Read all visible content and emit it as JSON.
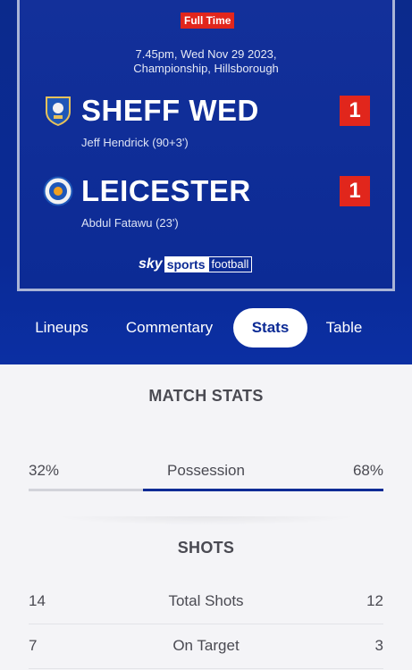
{
  "match": {
    "status": "Full Time",
    "datetime": "7.45pm, Wed Nov 29 2023,",
    "venue": "Championship, Hillsborough",
    "home": {
      "name": "SHEFF WED",
      "score": "1",
      "scorer": "Jeff Hendrick (90+3')"
    },
    "away": {
      "name": "LEICESTER",
      "score": "1",
      "scorer": "Abdul Fatawu (23')"
    },
    "broadcaster": {
      "sky": "sky",
      "sports": "sports",
      "football": "football"
    }
  },
  "tabs": [
    {
      "label": "Lineups"
    },
    {
      "label": "Commentary"
    },
    {
      "label": "Stats"
    },
    {
      "label": "Table"
    }
  ],
  "active_tab": "Stats",
  "stats": {
    "title": "MATCH STATS",
    "possession": {
      "label": "Possession",
      "home": "32%",
      "away": "68%",
      "home_fraction": 0.32,
      "away_fraction": 0.68
    },
    "shots_title": "SHOTS",
    "shots": [
      {
        "label": "Total Shots",
        "home": "14",
        "away": "12"
      },
      {
        "label": "On Target",
        "home": "7",
        "away": "3"
      }
    ]
  },
  "colors": {
    "brand_blue": "#0c2b95",
    "accent_red": "#e1261c",
    "bar_home": "#d2d3da",
    "bar_away": "#0c2b95"
  }
}
